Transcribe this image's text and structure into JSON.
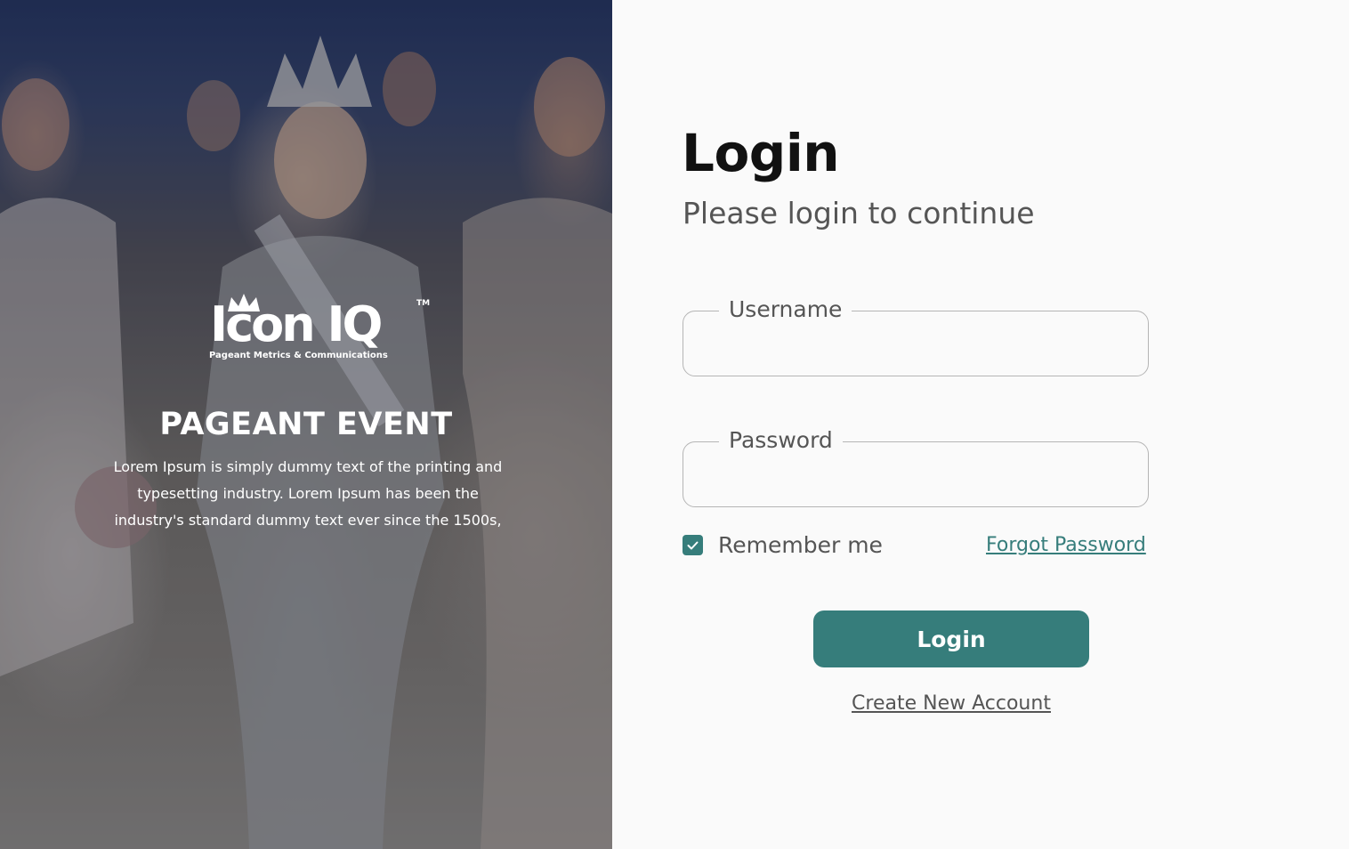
{
  "hero": {
    "logo_text": "Icon IQ",
    "logo_tm": "TM",
    "logo_tagline": "Pageant Metrics & Communications",
    "title": "PAGEANT EVENT",
    "description": "Lorem Ipsum is simply dummy text of the printing and typesetting industry. Lorem Ipsum has been the industry's standard dummy text ever since the 1500s,"
  },
  "login": {
    "title": "Login",
    "subtitle": "Please login to continue",
    "username_label": "Username",
    "username_value": "",
    "password_label": "Password",
    "password_value": "",
    "remember_label": "Remember me",
    "remember_checked": true,
    "forgot_label": "Forgot Password",
    "submit_label": "Login",
    "create_account_label": "Create New Account"
  },
  "colors": {
    "accent": "#367d7b",
    "panel_bg": "#fafafa",
    "text_dark": "#111111",
    "text_muted": "#555555"
  }
}
